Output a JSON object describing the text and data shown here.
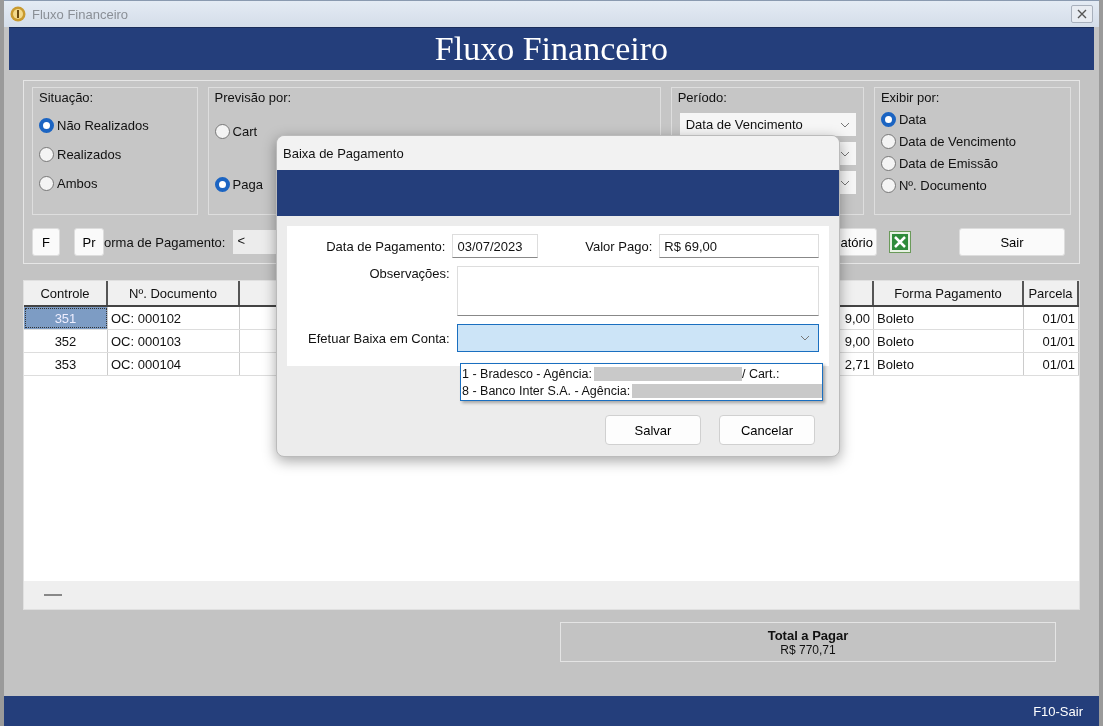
{
  "window": {
    "title": "Fluxo Financeiro"
  },
  "header": {
    "title": "Fluxo Financeiro"
  },
  "situacao": {
    "label": "Situação:",
    "options": [
      {
        "label": "Não Realizados",
        "selected": true
      },
      {
        "label": "Realizados",
        "selected": false
      },
      {
        "label": "Ambos",
        "selected": false
      }
    ]
  },
  "previsao": {
    "label": "Previsão por:",
    "options": [
      {
        "label": "Cart",
        "selected": false
      },
      {
        "label": "Paga",
        "selected": true
      }
    ]
  },
  "periodo": {
    "label": "Período:",
    "combo": "Data de Vencimento"
  },
  "exibir": {
    "label": "Exibir por:",
    "options": [
      {
        "label": "Data",
        "selected": true
      },
      {
        "label": "Data de Vencimento",
        "selected": false
      },
      {
        "label": "Data de Emissão",
        "selected": false
      },
      {
        "label": "Nº. Documento",
        "selected": false
      }
    ]
  },
  "toolbar": {
    "f_button": "F",
    "pr_button": "Pr",
    "payment_method_label": "orma de Pagamento:",
    "payment_method_combo": "<",
    "report_button": "atório",
    "exit_button": "Sair"
  },
  "table": {
    "columns": [
      "Controle",
      "Nº. Documento",
      "Forma Pagamento",
      "Parcela"
    ],
    "rows": [
      {
        "controle": "351",
        "documento": "OC: 000102",
        "column_3": "9,00",
        "forma_pagamento": "Boleto",
        "parcela": "01/01",
        "selected": true
      },
      {
        "controle": "352",
        "documento": "OC: 000103",
        "column_3": "9,00",
        "forma_pagamento": "Boleto",
        "parcela": "01/01",
        "selected": false
      },
      {
        "controle": "353",
        "documento": "OC: 000104",
        "column_3": "2,71",
        "forma_pagamento": "Boleto",
        "parcela": "01/01",
        "selected": false
      }
    ]
  },
  "total": {
    "label": "Total a Pagar",
    "value": "R$ 770,71"
  },
  "status_bar": {
    "shortcut": "F10-Sair"
  },
  "dialog": {
    "title": "Baixa de Pagamento",
    "payment_date": {
      "label": "Data de Pagamento:",
      "value": "03/07/2023"
    },
    "amount_paid": {
      "label": "Valor Pago:",
      "value": "R$ 69,00"
    },
    "notes": {
      "label": "Observações:"
    },
    "account": {
      "label": "Efetuar Baixa em Conta:",
      "options": [
        {
          "text": "1 - Bradesco - Agência:",
          "suffix": "/ Cart.:"
        },
        {
          "text": "8 - Banco Inter S.A. - Agência:"
        }
      ]
    },
    "buttons": [
      "Salvar",
      "Cancelar"
    ]
  }
}
